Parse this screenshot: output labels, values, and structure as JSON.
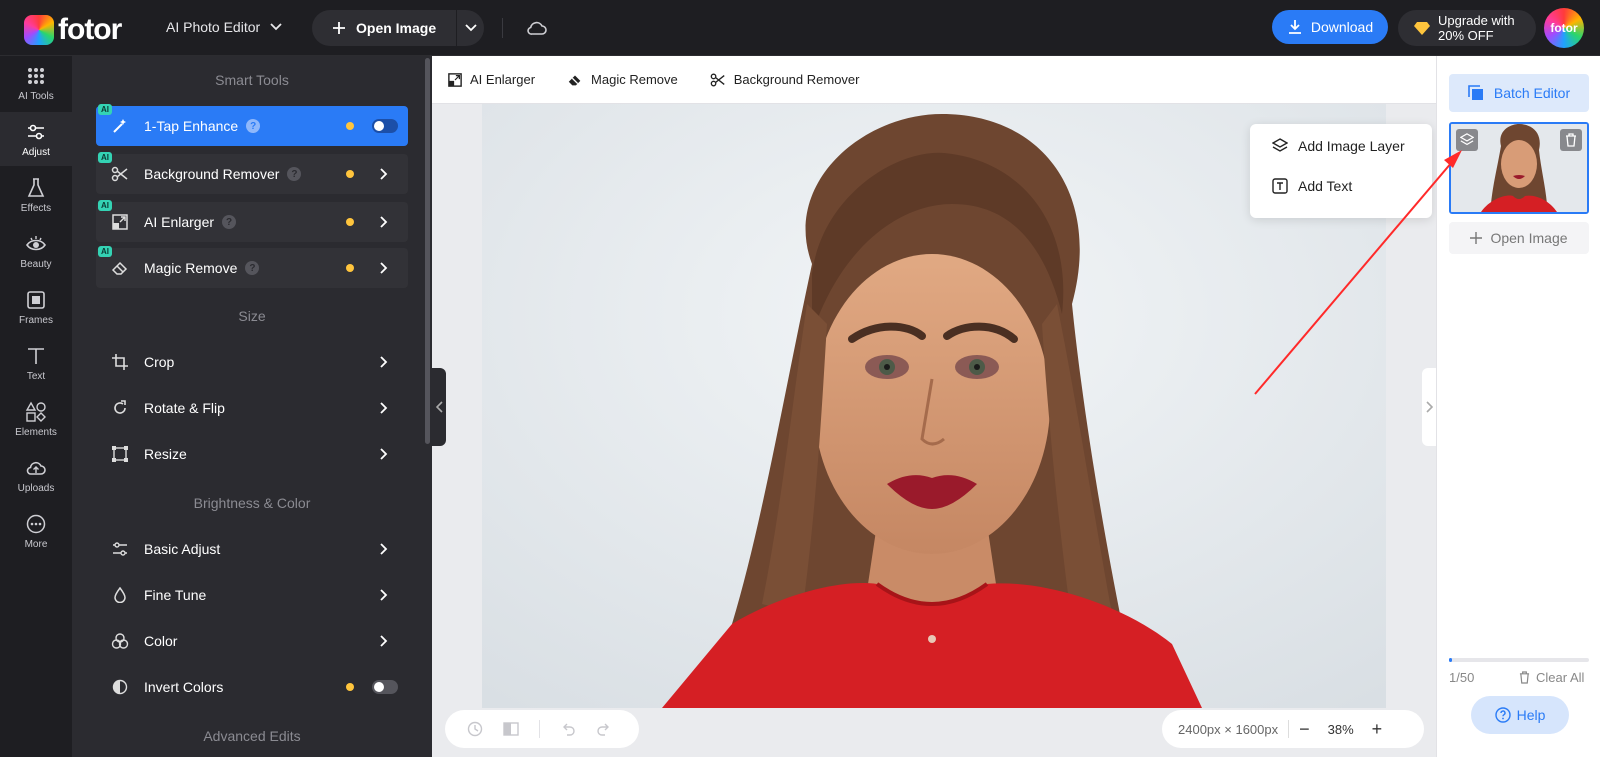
{
  "topbar": {
    "logo_text": "fotor",
    "editor_switch": "AI Photo Editor",
    "open_image": "Open Image",
    "download": "Download",
    "upgrade_line1": "Upgrade with",
    "upgrade_line2": "20% OFF",
    "avatar_text": "fotor",
    "accent": "#2a7bf6"
  },
  "rail": {
    "items": [
      {
        "label": "AI Tools",
        "icon": "grid-dots-icon"
      },
      {
        "label": "Adjust",
        "icon": "sliders-icon"
      },
      {
        "label": "Effects",
        "icon": "flask-icon"
      },
      {
        "label": "Beauty",
        "icon": "eye-icon"
      },
      {
        "label": "Frames",
        "icon": "frame-icon"
      },
      {
        "label": "Text",
        "icon": "text-icon"
      },
      {
        "label": "Elements",
        "icon": "shapes-icon"
      },
      {
        "label": "Uploads",
        "icon": "cloud-upload-icon"
      },
      {
        "label": "More",
        "icon": "more-icon"
      }
    ],
    "active": "Adjust"
  },
  "panel": {
    "smart_tools_title": "Smart Tools",
    "smart_tools": [
      {
        "label": "1-Tap Enhance",
        "badge": "AI",
        "icon": "magic-wand-icon",
        "active": true,
        "toggle": true
      },
      {
        "label": "Background Remover",
        "badge": "AI",
        "icon": "scissors-icon"
      },
      {
        "label": "AI Enlarger",
        "badge": "AI",
        "icon": "enlarge-icon"
      },
      {
        "label": "Magic Remove",
        "badge": "AI",
        "icon": "eraser-icon"
      }
    ],
    "size_title": "Size",
    "size_tools": [
      {
        "label": "Crop",
        "icon": "crop-icon"
      },
      {
        "label": "Rotate & Flip",
        "icon": "rotate-icon"
      },
      {
        "label": "Resize",
        "icon": "resize-icon"
      }
    ],
    "brightness_title": "Brightness & Color",
    "brightness_tools": [
      {
        "label": "Basic Adjust",
        "icon": "sliders-icon"
      },
      {
        "label": "Fine Tune",
        "icon": "drop-icon"
      },
      {
        "label": "Color",
        "icon": "color-circles-icon"
      },
      {
        "label": "Invert Colors",
        "icon": "invert-icon",
        "toggle": false
      }
    ],
    "advanced_title": "Advanced Edits",
    "help_glyph": "?"
  },
  "subtoolbar": {
    "items": [
      {
        "label": "AI Enlarger",
        "icon": "enlarge-icon"
      },
      {
        "label": "Magic Remove",
        "icon": "eraser-icon"
      },
      {
        "label": "Background Remover",
        "icon": "scissors-icon"
      }
    ]
  },
  "context_menu": {
    "add_image_layer": "Add Image Layer",
    "add_text": "Add Text"
  },
  "canvas": {
    "dimensions": "2400px × 1600px",
    "zoom": "38%",
    "zoom_out": "−",
    "zoom_in": "+"
  },
  "right_panel": {
    "batch_editor": "Batch Editor",
    "open_image": "Open Image",
    "count": "1/50",
    "progress_fraction": 0.02,
    "clear_all": "Clear All",
    "help": "Help"
  },
  "annotation": {
    "arrow_color": "#ff2a2a"
  }
}
